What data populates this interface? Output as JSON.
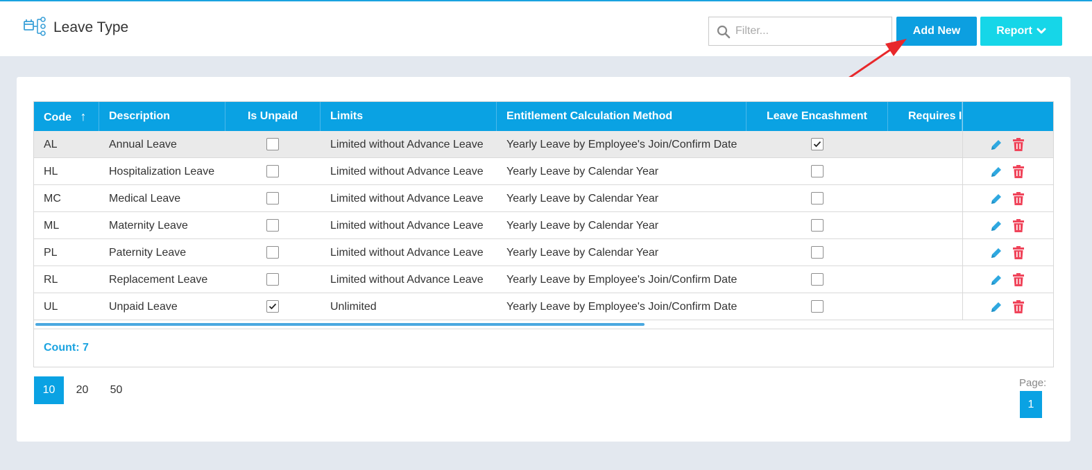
{
  "header": {
    "title": "Leave Type",
    "filter_placeholder": "Filter...",
    "add_new_label": "Add New",
    "report_label": "Report"
  },
  "table": {
    "columns": [
      "Code",
      "Description",
      "Is Unpaid",
      "Limits",
      "Entitlement Calculation Method",
      "Leave Encashment",
      "Requires I"
    ],
    "rows": [
      {
        "code": "AL",
        "description": "Annual Leave",
        "is_unpaid": false,
        "limits": "Limited without Advance Leave",
        "method": "Yearly Leave by Employee's Join/Confirm Date",
        "encashment": true
      },
      {
        "code": "HL",
        "description": "Hospitalization Leave",
        "is_unpaid": false,
        "limits": "Limited without Advance Leave",
        "method": "Yearly Leave by Calendar Year",
        "encashment": false
      },
      {
        "code": "MC",
        "description": "Medical Leave",
        "is_unpaid": false,
        "limits": "Limited without Advance Leave",
        "method": "Yearly Leave by Calendar Year",
        "encashment": false
      },
      {
        "code": "ML",
        "description": "Maternity Leave",
        "is_unpaid": false,
        "limits": "Limited without Advance Leave",
        "method": "Yearly Leave by Calendar Year",
        "encashment": false
      },
      {
        "code": "PL",
        "description": "Paternity Leave",
        "is_unpaid": false,
        "limits": "Limited without Advance Leave",
        "method": "Yearly Leave by Calendar Year",
        "encashment": false
      },
      {
        "code": "RL",
        "description": "Replacement Leave",
        "is_unpaid": false,
        "limits": "Limited without Advance Leave",
        "method": "Yearly Leave by Employee's Join/Confirm Date",
        "encashment": false
      },
      {
        "code": "UL",
        "description": "Unpaid Leave",
        "is_unpaid": true,
        "limits": "Unlimited",
        "method": "Yearly Leave by Employee's Join/Confirm Date",
        "encashment": false
      }
    ],
    "count_label": "Count: 7",
    "sort_indicator": "↑"
  },
  "pagination": {
    "page_sizes": [
      "10",
      "20",
      "50"
    ],
    "active_page_size": "10",
    "page_label": "Page:",
    "current_page": "1"
  },
  "colors": {
    "accent": "#0aa2e3",
    "report": "#16d6e8",
    "delete": "#f0445a",
    "edit": "#2fa8e0",
    "arrow": "#e8282b"
  },
  "icons": {
    "title": "hierarchy-calendar-icon",
    "filter": "search-icon",
    "report": "chevron-down-icon",
    "edit": "pencil-icon",
    "delete": "trash-icon"
  }
}
